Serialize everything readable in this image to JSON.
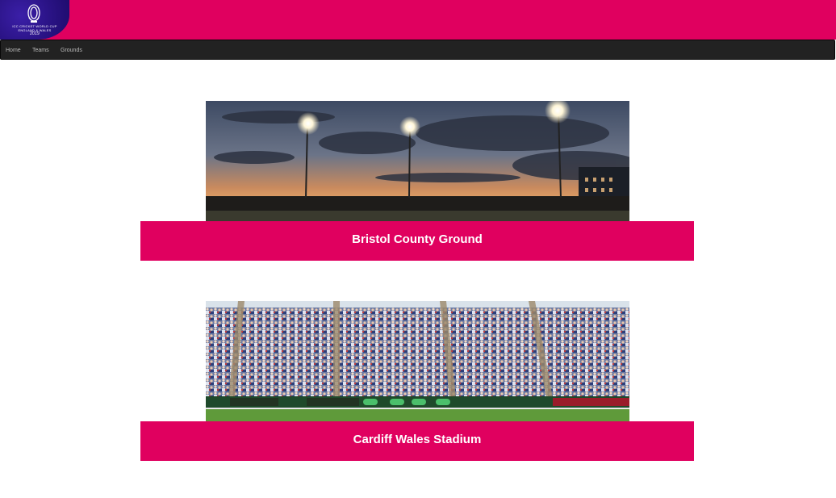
{
  "header": {
    "logo": {
      "line1": "ICC CRICKET WORLD CUP",
      "line2": "ENGLAND & WALES",
      "line3": "2019",
      "icon": "trophy-icon"
    },
    "banner_color": "#e0005f"
  },
  "nav": {
    "items": [
      {
        "label": "Home"
      },
      {
        "label": "Teams"
      },
      {
        "label": "Grounds"
      }
    ]
  },
  "grounds": [
    {
      "name": "Bristol County Ground",
      "image": "stadium-at-dusk-floodlights"
    },
    {
      "name": "Cardiff Wales Stadium",
      "image": "crowded-stadium-stands"
    }
  ],
  "colors": {
    "accent": "#e0005f",
    "nav_bg": "#222222",
    "logo_bg": "#2a1385"
  }
}
